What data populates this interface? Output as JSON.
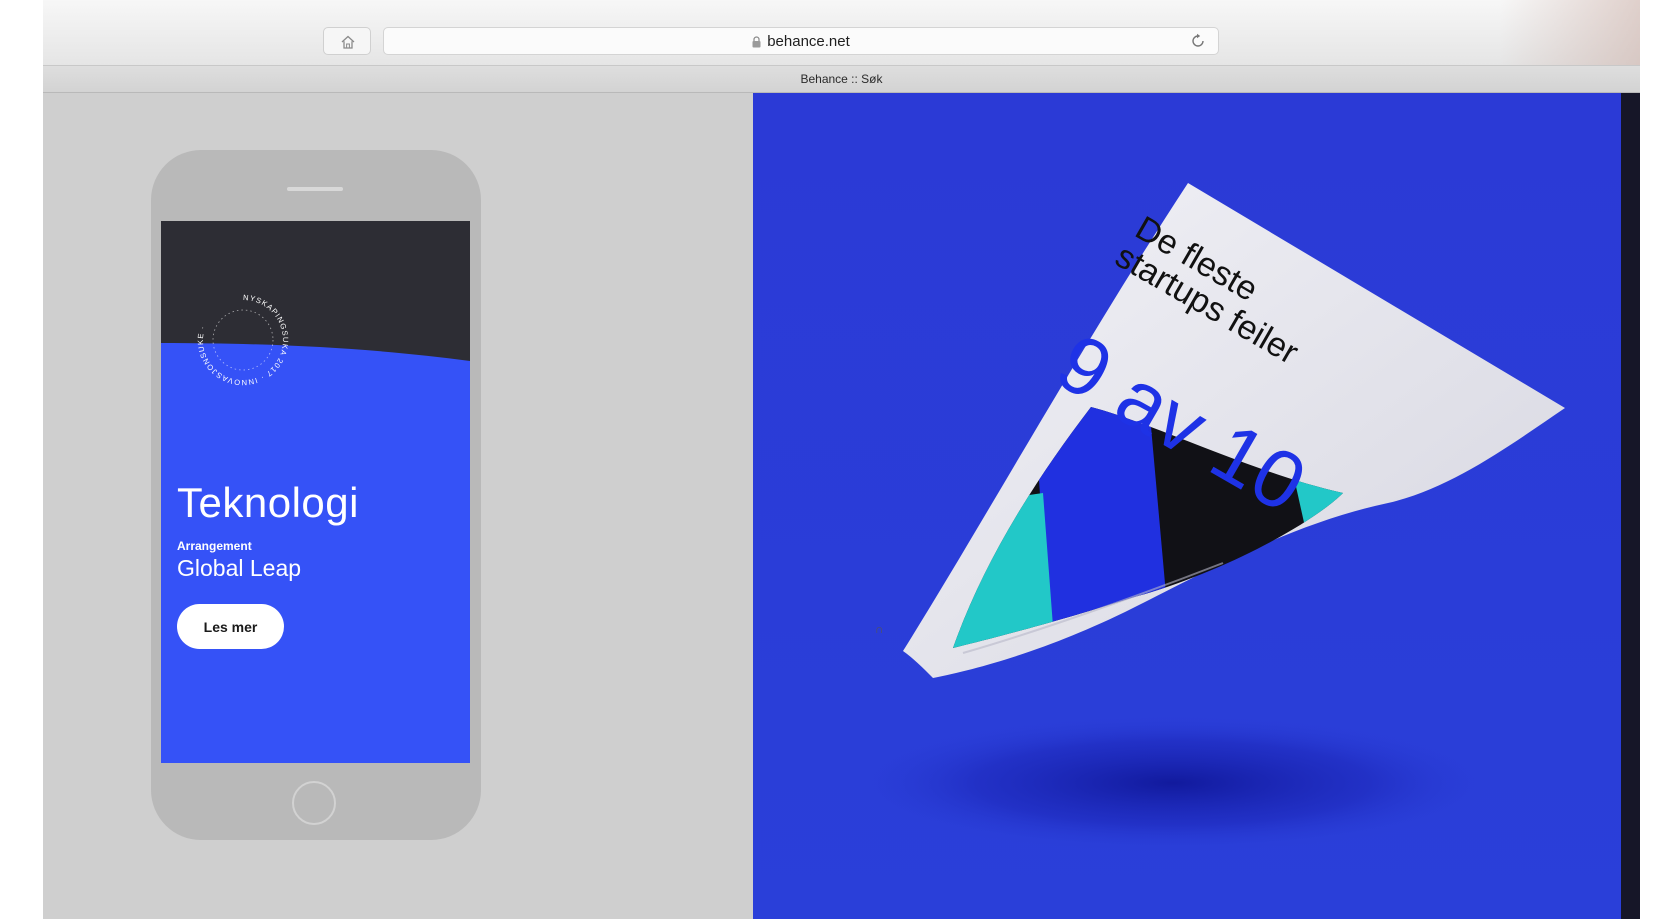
{
  "browser": {
    "url": "behance.net",
    "tab_title": "Behance :: Søk",
    "icons": {
      "home": "home-icon",
      "lock": "lock-icon",
      "reload": "reload-icon"
    }
  },
  "phone_mockup": {
    "badge_text": "NYSKAPINGSUKA 2017 · INNOVASJONSUKE ·",
    "title": "Teknologi",
    "subtitle": "Arrangement",
    "event": "Global Leap",
    "button": "Les mer",
    "colors": {
      "screen": "#3552f7",
      "header": "#2d2d34"
    }
  },
  "poster": {
    "headline_1": "De fleste",
    "headline_2": "startups feiler",
    "big_text": "9 av 10",
    "colors": {
      "background": "#2f3fd3",
      "paper": "#eeeef4",
      "accent_blue": "#2030e0",
      "accent_teal": "#22c8c8"
    }
  }
}
